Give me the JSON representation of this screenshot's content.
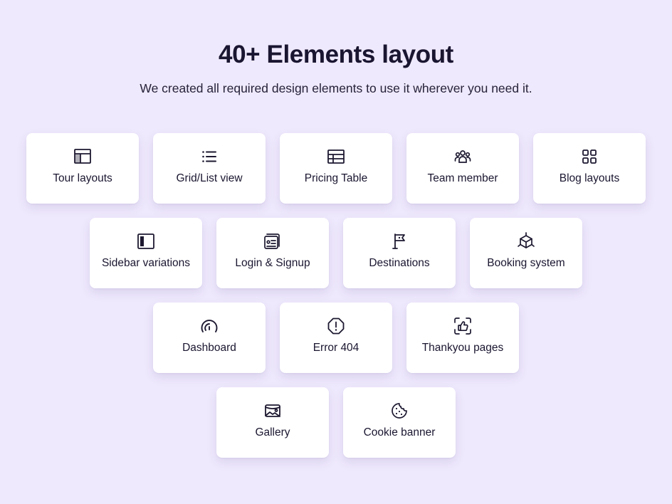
{
  "header": {
    "title": "40+ Elements layout",
    "subtitle": "We created all required design elements to use it wherever you need it."
  },
  "rows": [
    [
      {
        "label": "Tour layouts",
        "icon": "layout-icon"
      },
      {
        "label": "Grid/List view",
        "icon": "list-icon"
      },
      {
        "label": "Pricing Table",
        "icon": "table-icon"
      },
      {
        "label": "Team member",
        "icon": "users-icon"
      },
      {
        "label": "Blog layouts",
        "icon": "grid-icon"
      }
    ],
    [
      {
        "label": "Sidebar variations",
        "icon": "sidebar-icon"
      },
      {
        "label": "Login & Signup",
        "icon": "id-card-icon"
      },
      {
        "label": "Destinations",
        "icon": "flag-icon"
      },
      {
        "label": "Booking system",
        "icon": "cube-icon"
      }
    ],
    [
      {
        "label": "Dashboard",
        "icon": "gauge-icon"
      },
      {
        "label": "Error 404",
        "icon": "alert-octagon-icon"
      },
      {
        "label": "Thankyou pages",
        "icon": "thumbs-up-icon"
      }
    ],
    [
      {
        "label": "Gallery",
        "icon": "image-icon"
      },
      {
        "label": "Cookie banner",
        "icon": "cookie-icon"
      }
    ]
  ],
  "colors": {
    "background": "#efe9fd",
    "card": "#ffffff",
    "text": "#1a1530"
  }
}
